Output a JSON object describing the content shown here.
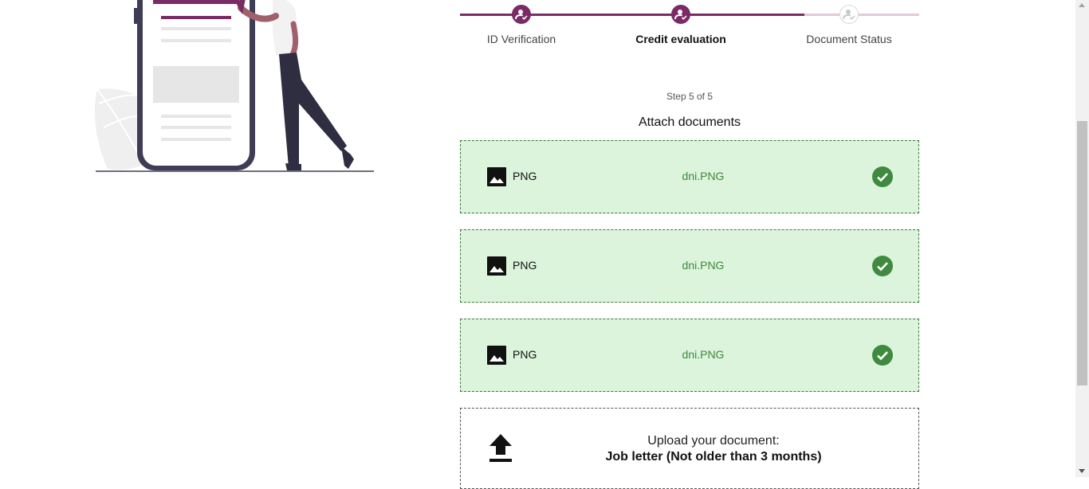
{
  "stepper": {
    "steps": [
      {
        "label": "ID Verification",
        "state": "done"
      },
      {
        "label": "Credit evaluation",
        "state": "current"
      },
      {
        "label": "Document Status",
        "state": "pending"
      }
    ]
  },
  "step_count": "Step 5 of 5",
  "section_title": "Attach documents",
  "documents": [
    {
      "type": "PNG",
      "file_name": "dni.PNG",
      "icon": "image-icon",
      "status_icon": "check-circle-icon"
    },
    {
      "type": "PNG",
      "file_name": "dni.PNG",
      "icon": "image-icon",
      "status_icon": "check-circle-icon"
    },
    {
      "type": "PNG",
      "file_name": "dni.PNG",
      "icon": "image-icon",
      "status_icon": "check-circle-icon"
    }
  ],
  "upload": {
    "prompt": "Upload your document:",
    "document_name": "Job letter (Not older than 3 months)",
    "icon": "upload-icon"
  },
  "colors": {
    "accent": "#7a2a64",
    "accent_light": "#e2c9db",
    "success_bg": "#dcf3dc",
    "success_text": "#3f8a3f",
    "success_icon": "#3f8a3f"
  }
}
